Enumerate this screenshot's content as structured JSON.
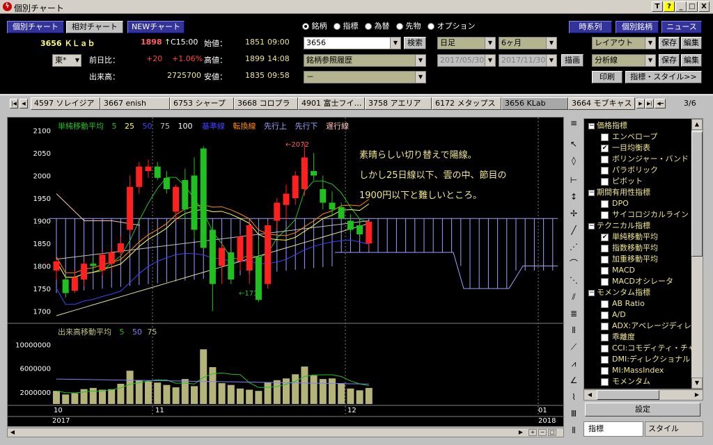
{
  "window": {
    "title": "個別チャート",
    "btn_t": "T",
    "btn_help": "?",
    "btn_min": "_",
    "btn_max": "□",
    "btn_close": "X"
  },
  "header": {
    "view_tabs": [
      "個別チャート",
      "相対チャート",
      "NEWチャート"
    ],
    "stock_name": "3656 ＫＬａｂ",
    "price": "1898",
    "price_arrow": "↑",
    "price_time": "C15:00",
    "labels": {
      "prev_diff": "前日比：",
      "volume": "出来高：",
      "open": "始値：",
      "high": "高値：",
      "low": "安値："
    },
    "prev_diff": "+20",
    "prev_pct": "+1.06%",
    "volume": "2725700",
    "open": "1851",
    "open_time": "09:00",
    "high": "1899",
    "high_time": "14:08",
    "low": "1835",
    "low_time": "09:58",
    "market": "東*",
    "market_arrow": "▼"
  },
  "radio": [
    {
      "label": "銘柄",
      "on": true
    },
    {
      "label": "指標",
      "on": false
    },
    {
      "label": "為替",
      "on": false
    },
    {
      "label": "先物",
      "on": false
    },
    {
      "label": "オプション",
      "on": false
    }
  ],
  "search": {
    "code": "3656",
    "search_btn": "検索",
    "history": "銘柄参照履歴",
    "third": "－"
  },
  "period": {
    "type": "日足",
    "range": "6ヶ月",
    "from": "2017/05/30",
    "to": "2017/11/30",
    "draw_btn": "描画"
  },
  "right_btns": {
    "timeseries": "時系列",
    "stock_info": "個別銘柄",
    "news": "ニュース",
    "layout": "レイアウト",
    "save1": "保存",
    "edit1": "編集",
    "analysis": "分析線",
    "save2": "保存",
    "edit2": "編集",
    "print": "印刷",
    "indicator_style": "指標・スタイル>>"
  },
  "stock_tabs": [
    "4597 ソレイジア",
    "3667 enish",
    "6753 シャープ",
    "3668 コロプラ",
    "4901 富士フイ…",
    "3758 アエリア",
    "6172 メタップス",
    "3656 KLab",
    "3664 モブキャス"
  ],
  "tab_page": "3/6",
  "chart_legend": {
    "sma": "単純移動平均",
    "p5": "5",
    "p25": "25",
    "p50": "50",
    "p75": "75",
    "p100": "100",
    "kijun": "基準線",
    "tenkan": "転換線",
    "senko_a": "先行上",
    "senko_b": "先行下",
    "chikou": "遅行線"
  },
  "vol_legend": {
    "label": "出来高移動平均",
    "p5": "5",
    "p50": "50",
    "p75": "75"
  },
  "annotation": [
    "素晴らしい切り替えで陽線。",
    "しかし25日線以下、雲の中、節目の",
    "1900円以下と難しいところ。"
  ],
  "price_marks": {
    "high": "←2072",
    "low": "←1710"
  },
  "x_labels": {
    "m10": "10",
    "m11": "11",
    "m12": "12",
    "m01": "01",
    "y2017": "2017",
    "y2018": "2018"
  },
  "colors": {
    "up": "#ff2020",
    "down": "#20c020",
    "bg": "#000000",
    "text": "#f0e68c"
  },
  "chart_data": {
    "type": "candlestick",
    "y_ticks": [
      2100,
      2050,
      2000,
      1950,
      1900,
      1850,
      1800,
      1750,
      1700
    ],
    "ylim": [
      1690,
      2110
    ],
    "candles": [
      {
        "o": 1790,
        "h": 1815,
        "l": 1770,
        "c": 1810
      },
      {
        "o": 1770,
        "h": 1780,
        "l": 1730,
        "c": 1740
      },
      {
        "o": 1745,
        "h": 1790,
        "l": 1740,
        "c": 1775
      },
      {
        "o": 1770,
        "h": 1810,
        "l": 1755,
        "c": 1805
      },
      {
        "o": 1805,
        "h": 1820,
        "l": 1790,
        "c": 1800
      },
      {
        "o": 1790,
        "h": 1830,
        "l": 1780,
        "c": 1825
      },
      {
        "o": 1805,
        "h": 1840,
        "l": 1790,
        "c": 1830
      },
      {
        "o": 1830,
        "h": 1865,
        "l": 1820,
        "c": 1850
      },
      {
        "o": 1880,
        "h": 2000,
        "l": 1870,
        "c": 1975
      },
      {
        "o": 1975,
        "h": 2030,
        "l": 1960,
        "c": 2020
      },
      {
        "o": 2010,
        "h": 2035,
        "l": 1995,
        "c": 2020
      },
      {
        "o": 2020,
        "h": 2030,
        "l": 1990,
        "c": 1995
      },
      {
        "o": 1995,
        "h": 2010,
        "l": 1960,
        "c": 1970
      },
      {
        "o": 1920,
        "h": 1980,
        "l": 1900,
        "c": 1975
      },
      {
        "o": 1990,
        "h": 2015,
        "l": 1900,
        "c": 1925
      },
      {
        "o": 2000,
        "h": 2040,
        "l": 1860,
        "c": 1880
      },
      {
        "o": 2060,
        "h": 2065,
        "l": 1840,
        "c": 1840
      },
      {
        "o": 1880,
        "h": 1895,
        "l": 1700,
        "c": 1760
      },
      {
        "o": 1800,
        "h": 1850,
        "l": 1760,
        "c": 1840
      },
      {
        "o": 1830,
        "h": 1840,
        "l": 1760,
        "c": 1770
      },
      {
        "o": 1810,
        "h": 1870,
        "l": 1790,
        "c": 1865
      },
      {
        "o": 1790,
        "h": 1900,
        "l": 1760,
        "c": 1890
      },
      {
        "o": 1820,
        "h": 1860,
        "l": 1720,
        "c": 1725
      },
      {
        "o": 1760,
        "h": 1900,
        "l": 1750,
        "c": 1890
      },
      {
        "o": 1900,
        "h": 1950,
        "l": 1880,
        "c": 1940
      },
      {
        "o": 1935,
        "h": 1980,
        "l": 1900,
        "c": 1960
      },
      {
        "o": 1950,
        "h": 2010,
        "l": 1935,
        "c": 2000
      },
      {
        "o": 1970,
        "h": 2072,
        "l": 1955,
        "c": 2040
      },
      {
        "o": 2010,
        "h": 2050,
        "l": 1990,
        "c": 2000
      },
      {
        "o": 1970,
        "h": 2000,
        "l": 1925,
        "c": 1940
      },
      {
        "o": 1940,
        "h": 1965,
        "l": 1910,
        "c": 1925
      },
      {
        "o": 1930,
        "h": 1940,
        "l": 1900,
        "c": 1905
      },
      {
        "o": 1900,
        "h": 1915,
        "l": 1870,
        "c": 1880
      },
      {
        "o": 1890,
        "h": 1905,
        "l": 1860,
        "c": 1870
      },
      {
        "o": 1850,
        "h": 1899,
        "l": 1835,
        "c": 1898
      }
    ],
    "volume_ticks": [
      10000000,
      6000000,
      2000000
    ],
    "volume": [
      2200000,
      1600000,
      1800000,
      2500000,
      2700000,
      2400000,
      2500000,
      3400000,
      5600000,
      4000000,
      3800000,
      3600000,
      3200000,
      2800000,
      4200000,
      3000000,
      9200000,
      6200000,
      3500000,
      3200000,
      2600000,
      2400000,
      2200000,
      3600000,
      4000000,
      4300000,
      5000000,
      6300000,
      4800000,
      4200000,
      4300000,
      3500000,
      2600000,
      2300000,
      2700000
    ]
  },
  "indicator_tree": [
    {
      "type": "group",
      "label": "価格指標"
    },
    {
      "type": "item",
      "label": "エンベロープ",
      "checked": false
    },
    {
      "type": "item",
      "label": "一目均衡表",
      "checked": true
    },
    {
      "type": "item",
      "label": "ボリンジャー・バンド",
      "checked": false
    },
    {
      "type": "item",
      "label": "パラボリック",
      "checked": false
    },
    {
      "type": "item",
      "label": "ピボット",
      "checked": false
    },
    {
      "type": "group",
      "label": "期間有用性指標"
    },
    {
      "type": "item",
      "label": "DPO",
      "checked": false
    },
    {
      "type": "item",
      "label": "サイコロジカルライン",
      "checked": false
    },
    {
      "type": "group",
      "label": "テクニカル指標"
    },
    {
      "type": "item",
      "label": "単純移動平均",
      "checked": true
    },
    {
      "type": "item",
      "label": "指数移動平均",
      "checked": false
    },
    {
      "type": "item",
      "label": "加重移動平均",
      "checked": false
    },
    {
      "type": "item",
      "label": "MACD",
      "checked": false
    },
    {
      "type": "item",
      "label": "MACDオシレータ",
      "checked": false
    },
    {
      "type": "group",
      "label": "モメンタム指標"
    },
    {
      "type": "item",
      "label": "AB Ratio",
      "checked": false
    },
    {
      "type": "item",
      "label": "A/D",
      "checked": false
    },
    {
      "type": "item",
      "label": "ADX:アベレージディレ",
      "checked": false
    },
    {
      "type": "item",
      "label": "乖離度",
      "checked": false
    },
    {
      "type": "item",
      "label": "CCI:コモディティ・チャ",
      "checked": false
    },
    {
      "type": "item",
      "label": "DMI:ディレクショナル",
      "checked": false
    },
    {
      "type": "item",
      "label": "MI:MassIndex",
      "checked": false
    },
    {
      "type": "item",
      "label": "モメンタム",
      "checked": false
    }
  ],
  "panel": {
    "settings_btn": "設定",
    "tab_indicators": "指標",
    "tab_style": "スタイル"
  }
}
